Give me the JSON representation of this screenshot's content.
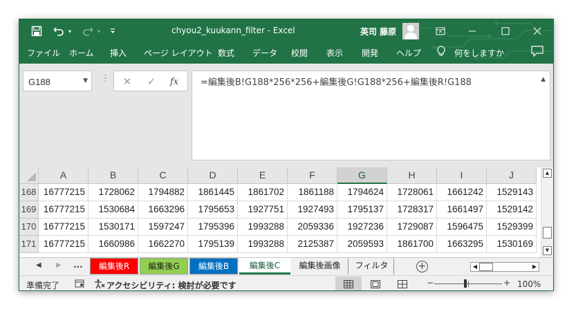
{
  "titlebar": {
    "title": "chyou2_kuukann_filter  -  Excel",
    "user": "英司 藤原",
    "icons": [
      "save-icon",
      "undo-icon",
      "redo-icon",
      "customize-quick-access-icon",
      "ribbon-display-icon",
      "minimize-icon",
      "maximize-icon",
      "close-icon"
    ]
  },
  "ribbon": {
    "tabs": [
      "ファイル",
      "ホーム",
      "挿入",
      "ページ レイアウト",
      "数式",
      "データ",
      "校閲",
      "表示",
      "開発",
      "ヘルプ",
      "何をしますか"
    ]
  },
  "formula_bar": {
    "name_box": "G188",
    "formula": "=編集後B!G188*256*256+編集後G!G188*256+編集後R!G188"
  },
  "grid": {
    "columns": [
      "A",
      "B",
      "C",
      "D",
      "E",
      "F",
      "G",
      "H",
      "I",
      "J"
    ],
    "selected_column": "G",
    "rows": [
      {
        "num": "168",
        "cells": [
          "16777215",
          "1728062",
          "1794882",
          "1861445",
          "1861702",
          "1861188",
          "1794624",
          "1728061",
          "1661242",
          "1529143"
        ]
      },
      {
        "num": "169",
        "cells": [
          "16777215",
          "1530684",
          "1663296",
          "1795653",
          "1927751",
          "1927493",
          "1795137",
          "1728317",
          "1661497",
          "1529142"
        ]
      },
      {
        "num": "170",
        "cells": [
          "16777215",
          "1530171",
          "1597247",
          "1795396",
          "1993288",
          "2059336",
          "1927236",
          "1729087",
          "1596475",
          "1529399"
        ]
      },
      {
        "num": "171",
        "cells": [
          "16777215",
          "1660986",
          "1662270",
          "1795139",
          "1993288",
          "2125387",
          "2059593",
          "1861700",
          "1663295",
          "1530169"
        ]
      }
    ]
  },
  "sheet_tabs": {
    "more": "...",
    "tabs": [
      {
        "label": "編集後R",
        "bg": "#ff0000",
        "fg": "#ffffff"
      },
      {
        "label": "編集後G",
        "bg": "#92d050",
        "fg": "#222222"
      },
      {
        "label": "編集後B",
        "bg": "#0070c0",
        "fg": "#ffffff"
      },
      {
        "label": "編集後C",
        "bg": "#ffffff",
        "fg": "#1a5c37",
        "active": true
      },
      {
        "label": "編集後画像",
        "bg": "#f0f0f0",
        "fg": "#222222"
      },
      {
        "label": "フィルタ",
        "bg": "#f0f0f0",
        "fg": "#222222"
      }
    ]
  },
  "statusbar": {
    "ready": "準備完了",
    "accessibility": "アクセシビリティ: 検討が必要です",
    "zoom": "100%",
    "zoom_minus": "−",
    "zoom_plus": "+"
  },
  "colors": {
    "accent": "#217346",
    "header_bg": "#e6e6e6"
  }
}
